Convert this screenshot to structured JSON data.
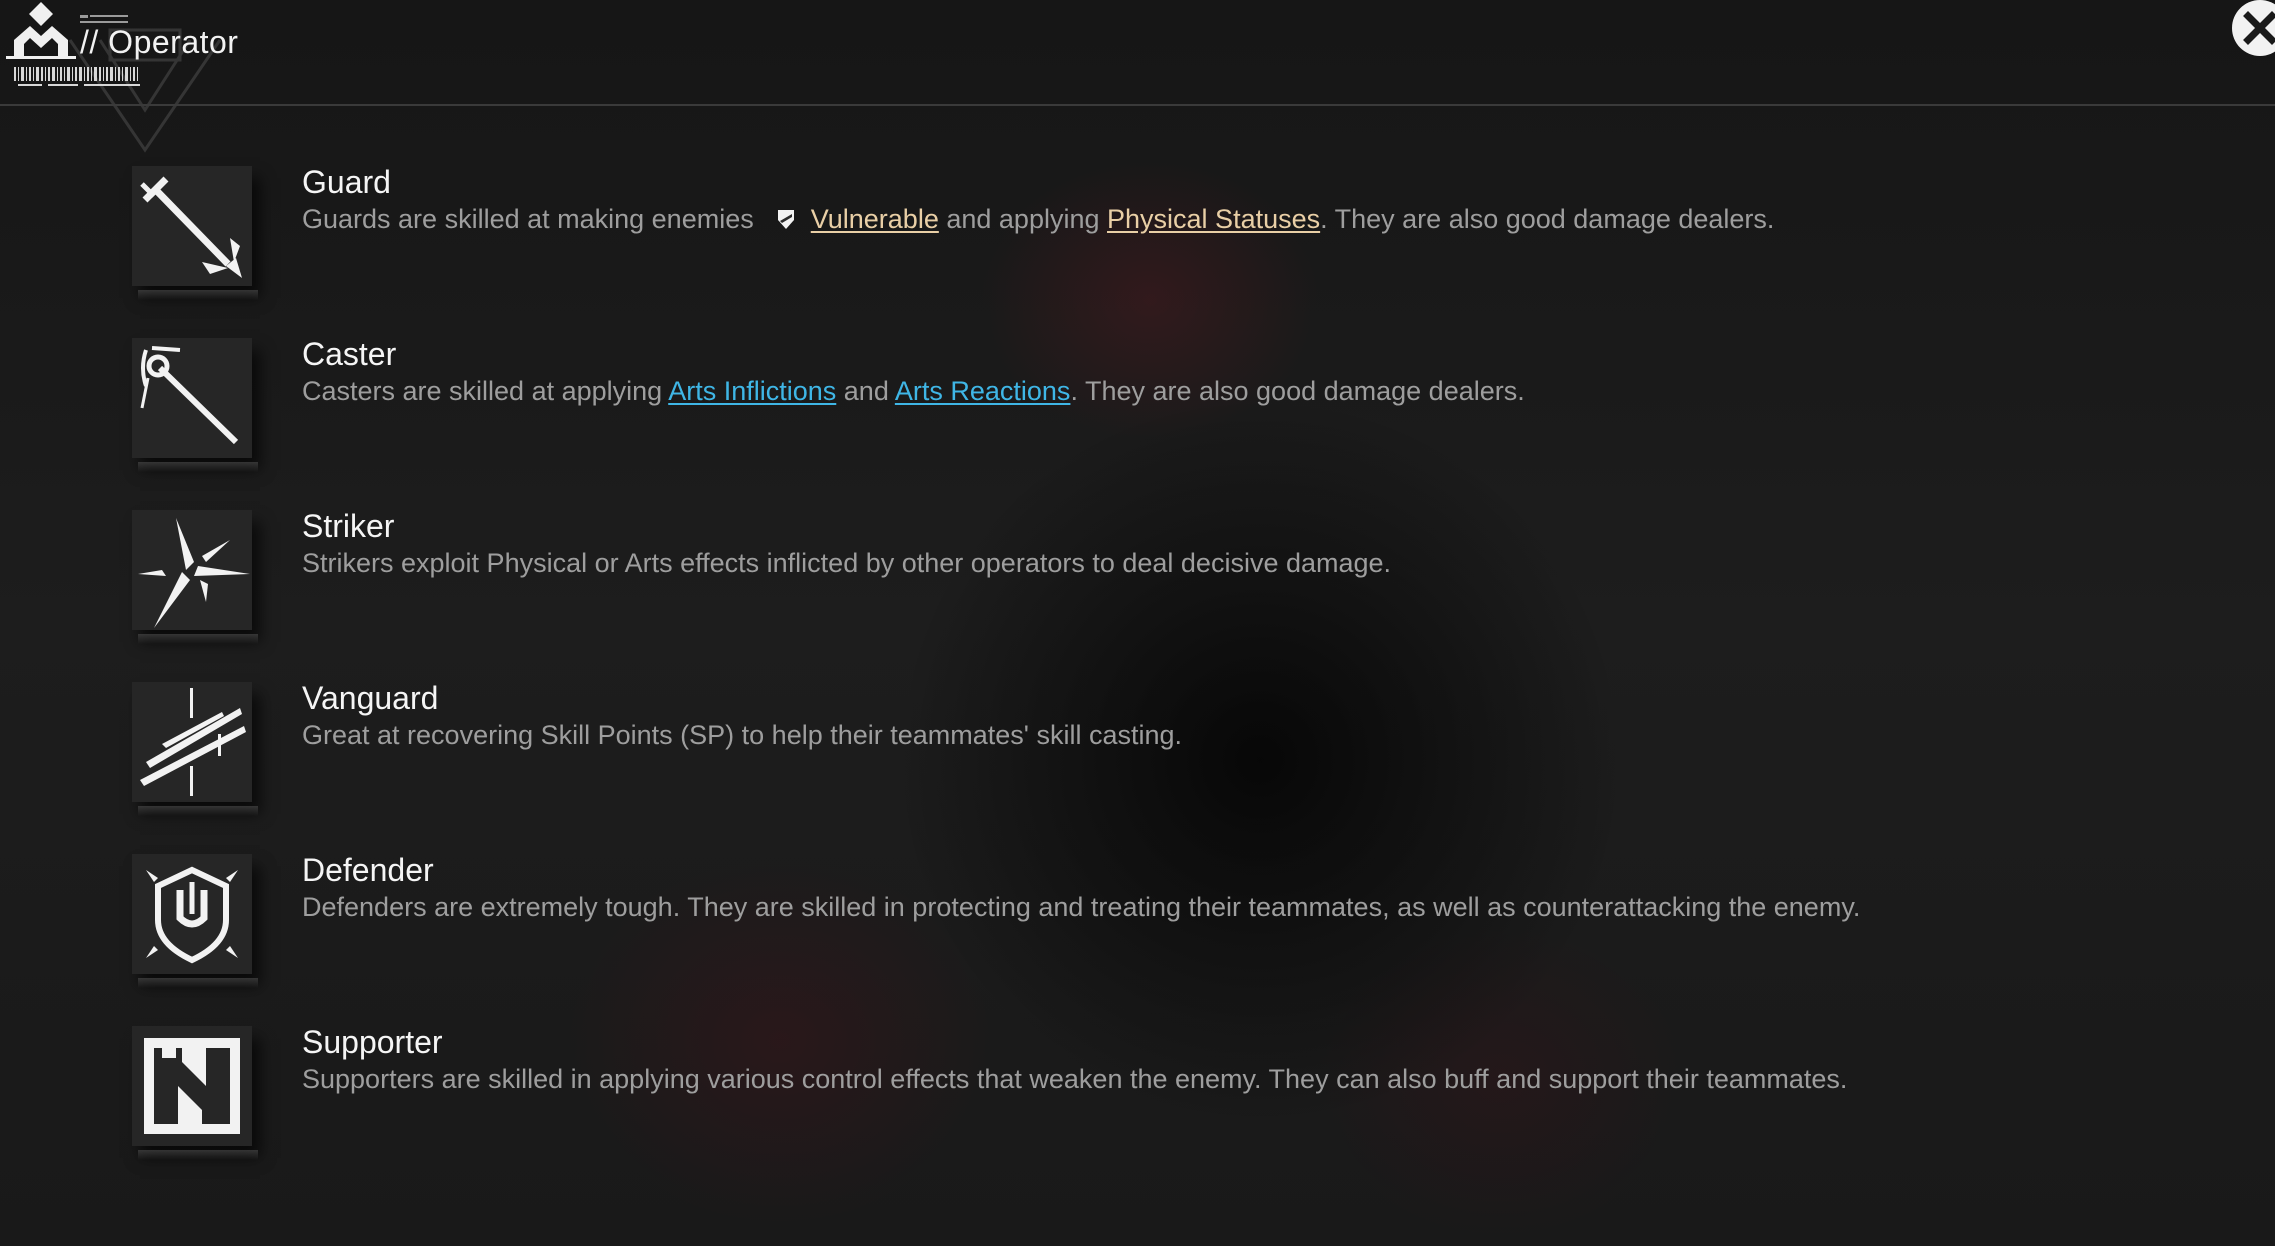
{
  "header": {
    "title": "// Operator"
  },
  "classes": [
    {
      "id": "guard",
      "icon": "sword-icon",
      "name": "Guard",
      "desc_before": "Guards are skilled at making enemies",
      "keyword_1": "Vulnerable",
      "desc_mid": "and applying",
      "keyword_2": "Physical Statuses",
      "desc_after": ". They are also good damage dealers."
    },
    {
      "id": "caster",
      "icon": "staff-icon",
      "name": "Caster",
      "desc_before": "Casters are skilled at applying",
      "keyword_1": "Arts Inflictions",
      "desc_mid": "and",
      "keyword_2": "Arts Reactions",
      "desc_after": ". They are also good damage dealers."
    },
    {
      "id": "striker",
      "icon": "shuriken-icon",
      "name": "Striker",
      "desc": "Strikers exploit Physical or Arts effects inflicted by other operators to deal decisive damage."
    },
    {
      "id": "vanguard",
      "icon": "slash-icon",
      "name": "Vanguard",
      "desc": "Great at recovering Skill Points (SP) to help their teammates' skill casting."
    },
    {
      "id": "defender",
      "icon": "shield-icon",
      "name": "Defender",
      "desc": "Defenders are extremely tough. They are skilled in protecting and treating their teammates, as well as counterattacking the enemy."
    },
    {
      "id": "supporter",
      "icon": "support-block-icon",
      "name": "Supporter",
      "desc": "Supporters are skilled in applying various control effects that weaken the enemy. They can also buff and support their teammates."
    }
  ],
  "colors": {
    "keyword_physical": "#e9cfa6",
    "keyword_arts": "#3fb6e6",
    "desc_text": "#9e9e9e",
    "title_text": "#f5f5f5"
  }
}
